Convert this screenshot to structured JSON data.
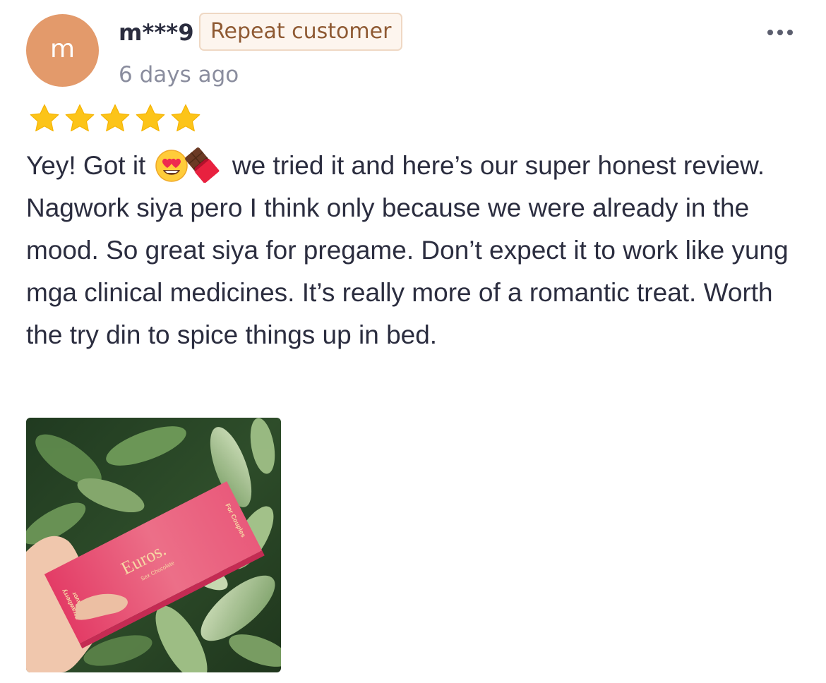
{
  "review": {
    "avatar_letter": "m",
    "username": "m***9",
    "badge": "Repeat customer",
    "date": "6 days ago",
    "rating": 5,
    "rating_max": 5,
    "text_before_emoji": "Yey! Got it",
    "emojis": [
      "smiling-face-with-heart-eyes",
      "chocolate-bar"
    ],
    "text_after_emoji": "we tried it and here’s our super honest review. Nagwork siya pero I think only because we were already in the mood. So great siya for pregame. Don’t expect it to work like yung mga clinical medicines. It’s really more of a romantic treat. Worth the try din to spice things up in bed."
  },
  "photo": {
    "brand": "Euros.",
    "product": "Sex Chocolate",
    "flavor_line1": "Strawberry",
    "flavor_line2": "Flavor",
    "side_label": "For Couples"
  },
  "colors": {
    "avatar_bg": "#e39a6b",
    "badge_bg": "#fdf5ee",
    "badge_border": "#efd8c4",
    "badge_text": "#8f5a33",
    "star": "#fcc419",
    "text": "#2b2d3f",
    "muted": "#8a8d9e",
    "box_pink": "#e0466f"
  },
  "icons": {
    "menu": "more-horizontal-icon",
    "star": "star-icon"
  }
}
